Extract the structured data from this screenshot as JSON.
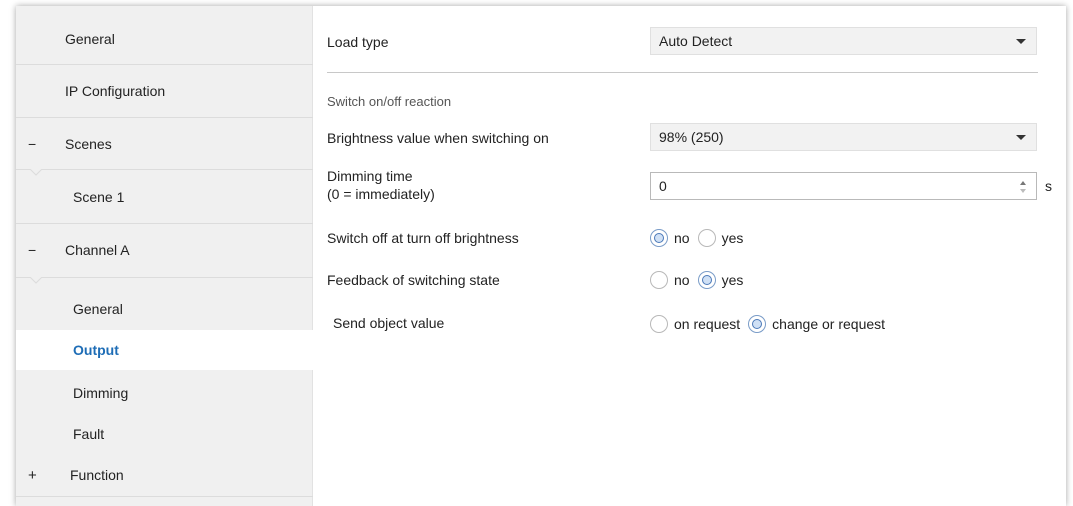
{
  "sidebar": {
    "items": [
      {
        "label": "General"
      },
      {
        "label": "IP Configuration"
      },
      {
        "label": "Scenes",
        "expander": "−"
      },
      {
        "label": "Scene 1"
      },
      {
        "label": "Channel A",
        "expander": "−"
      },
      {
        "label": "General"
      },
      {
        "label": "Output",
        "active": true
      },
      {
        "label": "Dimming"
      },
      {
        "label": "Fault"
      },
      {
        "label": "Function",
        "expander": "+"
      }
    ]
  },
  "main": {
    "load_type": {
      "label": "Load type",
      "value": "Auto Detect"
    },
    "section_title": "Switch on/off reaction",
    "brightness": {
      "label": "Brightness value when switching on",
      "value": "98% (250)"
    },
    "dimming_time": {
      "label_line1": "Dimming time",
      "label_line2": "(0 = immediately)",
      "value": "0",
      "unit": "s"
    },
    "switch_off": {
      "label": "Switch off at turn off brightness",
      "options": [
        "no",
        "yes"
      ],
      "selected": "no"
    },
    "feedback": {
      "label": "Feedback of switching state",
      "options": [
        "no",
        "yes"
      ],
      "selected": "yes"
    },
    "send_object": {
      "label": "Send object value",
      "options": [
        "on request",
        "change or request"
      ],
      "selected": "change or request"
    }
  },
  "colors": {
    "accent": "#1e6db6",
    "sidebar_bg": "#f0f0f0"
  }
}
